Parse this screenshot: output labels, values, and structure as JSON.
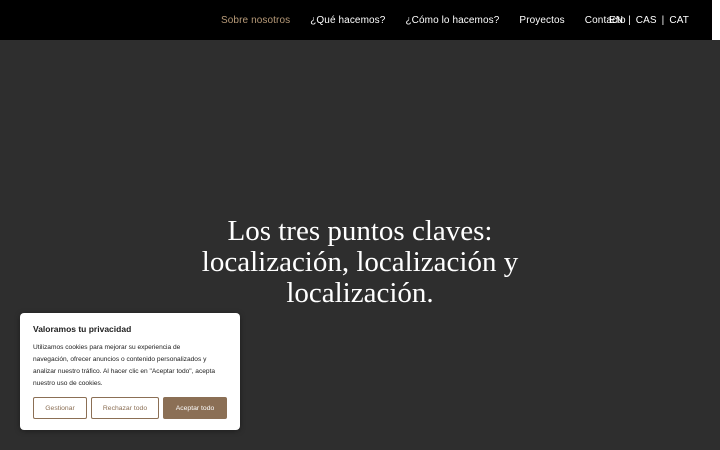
{
  "nav": {
    "items": [
      {
        "label": "Sobre nosotros",
        "active": true
      },
      {
        "label": "¿Qué hacemos?",
        "active": false
      },
      {
        "label": "¿Cómo lo hacemos?",
        "active": false
      },
      {
        "label": "Proyectos",
        "active": false
      },
      {
        "label": "Contacto",
        "active": false
      }
    ],
    "languages": [
      "EN",
      "CAS",
      "CAT"
    ],
    "separator": "|"
  },
  "hero": {
    "lines": [
      "Los tres puntos claves:",
      "localización, localización y",
      "localización."
    ]
  },
  "cookie_banner": {
    "title": "Valoramos tu privacidad",
    "text_lines": [
      "Utilizamos cookies para mejorar su experiencia de",
      "navegación, ofrecer anuncios o contenido personalizados y",
      "analizar nuestro tráfico. Al hacer clic en \"Aceptar todo\", acepta",
      "nuestro uso de cookies."
    ],
    "buttons": {
      "customize": "Gestionar",
      "reject": "Rechazar todo",
      "accept": "Aceptar todo"
    }
  },
  "colors": {
    "topbar": "#000000",
    "background": "#2e2e2e",
    "accent": "#8b6f55",
    "nav_active": "#b79a78"
  }
}
